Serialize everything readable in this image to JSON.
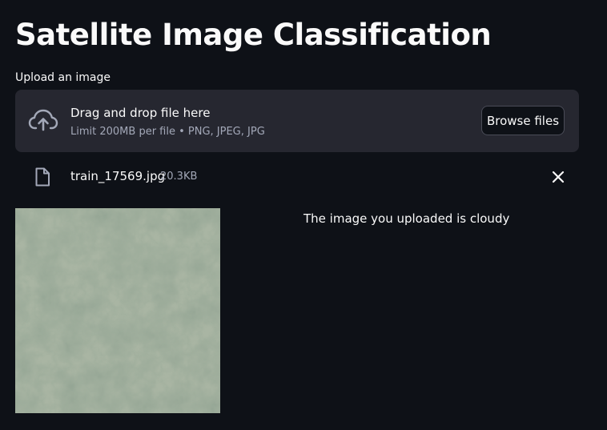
{
  "page": {
    "title": "Satellite Image Classification"
  },
  "uploader": {
    "label": "Upload an image",
    "dropzone_title": "Drag and drop file here",
    "dropzone_limit": "Limit 200MB per file • PNG, JPEG, JPG",
    "browse_label": "Browse files",
    "upload_icon": "cloud-upload-icon"
  },
  "file": {
    "name": "train_17569.jpg",
    "size": "20.3KB",
    "icon": "file-icon",
    "remove_icon": "close-icon"
  },
  "result": {
    "text": "The image you uploaded is cloudy"
  },
  "colors": {
    "background": "#0e1117",
    "dropzone": "#262730",
    "muted_text": "#a3a8b8",
    "text": "#fafafa"
  }
}
